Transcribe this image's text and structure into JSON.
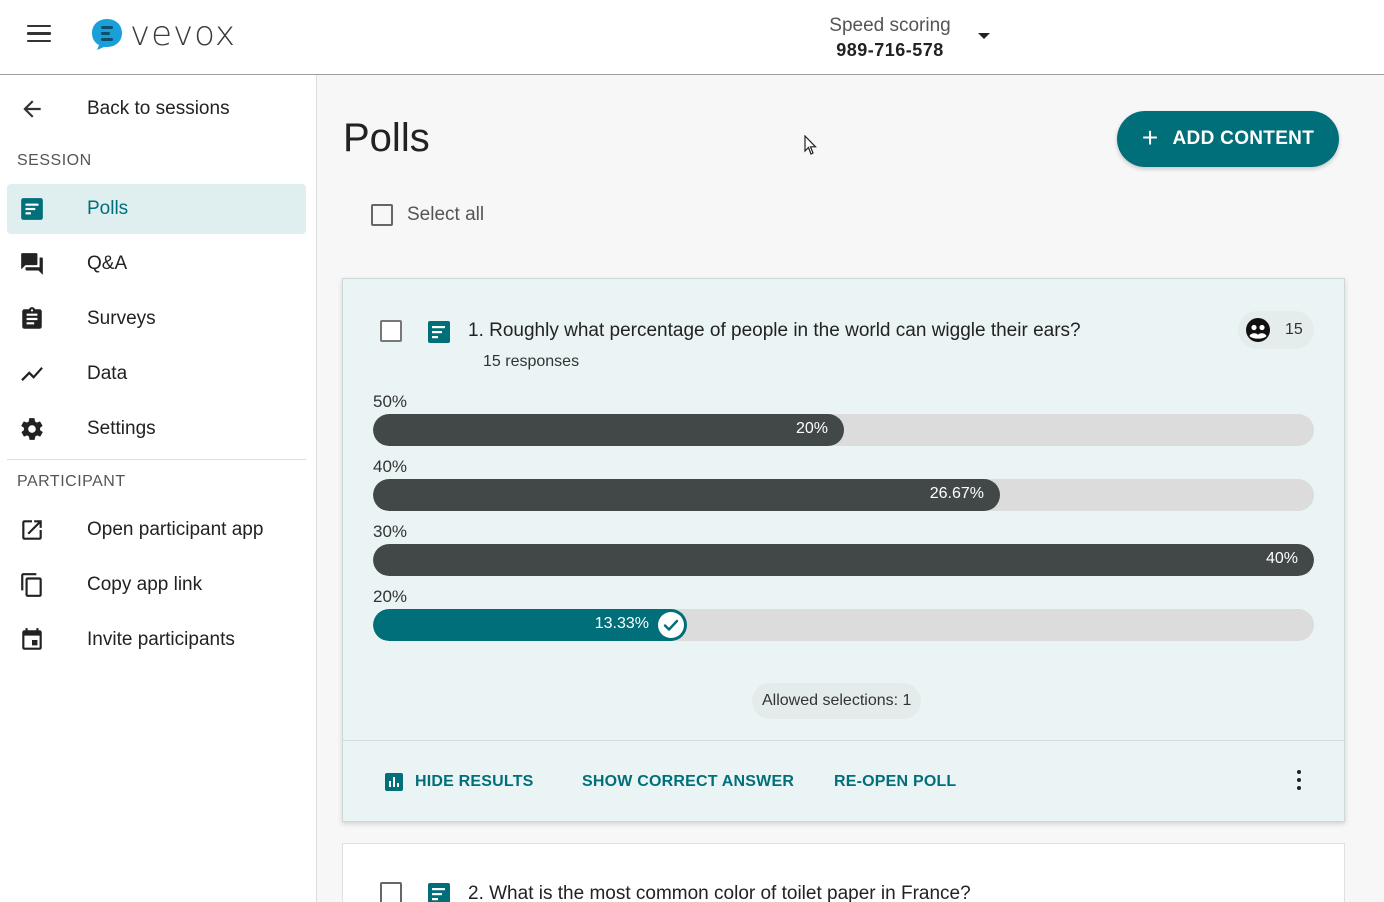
{
  "header": {
    "logo_text": "vevox",
    "session_name": "Speed scoring",
    "session_code": "989-716-578"
  },
  "sidebar": {
    "back_label": "Back to sessions",
    "session_section": "SESSION",
    "participant_section": "PARTICIPANT",
    "items": [
      {
        "label": "Polls",
        "icon": "poll-icon",
        "active": true
      },
      {
        "label": "Q&A",
        "icon": "chat-icon"
      },
      {
        "label": "Surveys",
        "icon": "clipboard-icon"
      },
      {
        "label": "Data",
        "icon": "trend-icon"
      },
      {
        "label": "Settings",
        "icon": "gear-icon"
      }
    ],
    "participant_items": [
      {
        "label": "Open participant app",
        "icon": "open-external-icon"
      },
      {
        "label": "Copy app link",
        "icon": "copy-icon"
      },
      {
        "label": "Invite participants",
        "icon": "calendar-icon"
      }
    ]
  },
  "main": {
    "title": "Polls",
    "add_content_label": "ADD CONTENT",
    "select_all_label": "Select all"
  },
  "poll1": {
    "question": "1. Roughly what percentage of people in the world can wiggle their ears?",
    "responses_text": "15 responses",
    "response_count": "15",
    "options": [
      {
        "label": "50%",
        "value_text": "20%",
        "percent": 20,
        "correct": false
      },
      {
        "label": "40%",
        "value_text": "26.67%",
        "percent": 26.67,
        "correct": false
      },
      {
        "label": "30%",
        "value_text": "40%",
        "percent": 40,
        "correct": false
      },
      {
        "label": "20%",
        "value_text": "13.33%",
        "percent": 13.33,
        "correct": true
      }
    ],
    "allowed_selections": "Allowed selections: 1",
    "actions": {
      "hide_results": "HIDE RESULTS",
      "show_correct": "SHOW CORRECT ANSWER",
      "reopen": "RE-OPEN POLL"
    }
  },
  "poll2": {
    "question": "2. What is the most common color of toilet paper in France?"
  },
  "colors": {
    "accent": "#016f79",
    "bar_dark": "#424848",
    "bar_track": "#dcdcdc"
  }
}
